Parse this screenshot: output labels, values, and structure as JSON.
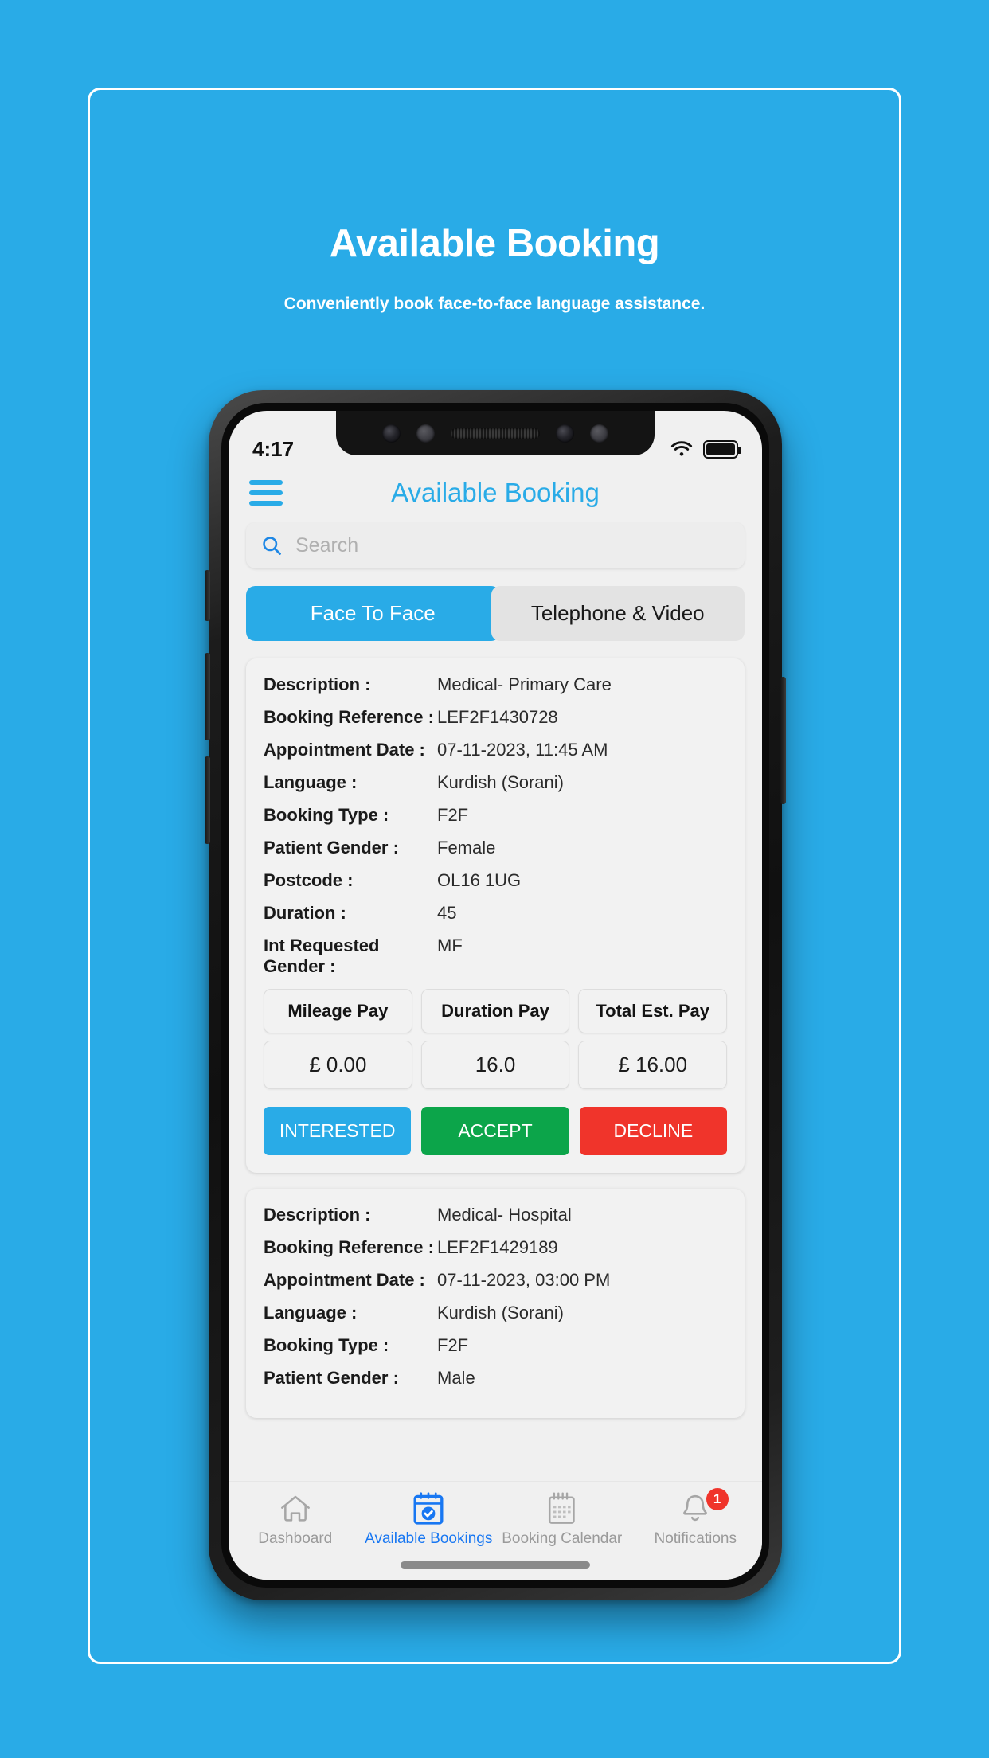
{
  "hero": {
    "title": "Available Booking",
    "subtitle": "Conveniently book face-to-face language assistance."
  },
  "colors": {
    "brand_blue": "#29ABE7",
    "accept_green": "#0CA54A",
    "decline_red": "#F0342B",
    "nav_active_blue": "#1877F2",
    "badge_red": "#F0342B"
  },
  "phone": {
    "statusbar": {
      "time": "4:17",
      "wifi_icon": "wifi-icon",
      "battery_icon": "battery-full-icon"
    },
    "appbar": {
      "menu_icon": "hamburger-menu-icon",
      "title": "Available Booking"
    },
    "search": {
      "icon": "search-icon",
      "placeholder": "Search",
      "value": ""
    },
    "tabs": [
      {
        "label": "Face To Face",
        "active": true
      },
      {
        "label": "Telephone & Video",
        "active": false
      }
    ],
    "cards": [
      {
        "fields": [
          {
            "label": "Description :",
            "value": "Medical- Primary Care"
          },
          {
            "label": "Booking Reference :",
            "value": "LEF2F1430728"
          },
          {
            "label": "Appointment Date :",
            "value": "07-11-2023, 11:45 AM"
          },
          {
            "label": "Language :",
            "value": "Kurdish (Sorani)"
          },
          {
            "label": "Booking Type :",
            "value": "F2F"
          },
          {
            "label": "Patient Gender :",
            "value": "Female"
          },
          {
            "label": "Postcode :",
            "value": "OL16 1UG"
          },
          {
            "label": "Duration :",
            "value": "45"
          },
          {
            "label": "Int Requested Gender :",
            "value": "MF"
          }
        ],
        "pay": {
          "headers": [
            "Mileage Pay",
            "Duration Pay",
            "Total Est. Pay"
          ],
          "values": [
            "£ 0.00",
            "16.0",
            "£ 16.00"
          ]
        },
        "actions": [
          {
            "label": "INTERESTED",
            "color": "#29ABE7"
          },
          {
            "label": "ACCEPT",
            "color": "#0CA54A"
          },
          {
            "label": "DECLINE",
            "color": "#F0342B"
          }
        ]
      },
      {
        "fields": [
          {
            "label": "Description :",
            "value": "Medical- Hospital"
          },
          {
            "label": "Booking Reference :",
            "value": "LEF2F1429189"
          },
          {
            "label": "Appointment Date :",
            "value": "07-11-2023, 03:00 PM"
          },
          {
            "label": "Language :",
            "value": "Kurdish (Sorani)"
          },
          {
            "label": "Booking Type :",
            "value": "F2F"
          },
          {
            "label": "Patient Gender :",
            "value": "Male"
          }
        ]
      }
    ],
    "bottom_nav": [
      {
        "label": "Dashboard",
        "icon": "home-icon",
        "active": false,
        "badge": ""
      },
      {
        "label": "Available Bookings",
        "icon": "calendar-check-icon",
        "active": true,
        "badge": ""
      },
      {
        "label": "Booking Calendar",
        "icon": "calendar-icon",
        "active": false,
        "badge": ""
      },
      {
        "label": "Notifications",
        "icon": "bell-icon",
        "active": false,
        "badge": "1"
      }
    ]
  }
}
